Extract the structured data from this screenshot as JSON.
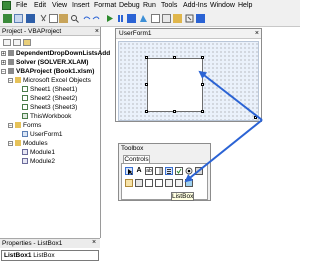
{
  "menu": {
    "items": [
      "File",
      "Edit",
      "View",
      "Insert",
      "Format",
      "Debug",
      "Run",
      "Tools",
      "Add-Ins",
      "Window",
      "Help"
    ]
  },
  "project": {
    "title": "Project - VBAProject",
    "close": "×",
    "tree": [
      {
        "label": "DependentDropDownListsAdd",
        "bold": true,
        "expander": "+"
      },
      {
        "label": "Solver (SOLVER.XLAM)",
        "bold": true,
        "expander": "+"
      },
      {
        "label": "VBAProject (Book1.xlsm)",
        "bold": true,
        "expander": "−"
      },
      {
        "label": "Microsoft Excel Objects",
        "bold": false,
        "expander": "−"
      },
      {
        "label": "Sheet1 (Sheet1)",
        "bold": false,
        "expander": ""
      },
      {
        "label": "Sheet2 (Sheet2)",
        "bold": false,
        "expander": ""
      },
      {
        "label": "Sheet3 (Sheet3)",
        "bold": false,
        "expander": ""
      },
      {
        "label": "ThisWorkbook",
        "bold": false,
        "expander": ""
      },
      {
        "label": "Forms",
        "bold": false,
        "expander": "−"
      },
      {
        "label": "UserForm1",
        "bold": false,
        "expander": ""
      },
      {
        "label": "Modules",
        "bold": false,
        "expander": "−"
      },
      {
        "label": "Module1",
        "bold": false,
        "expander": ""
      },
      {
        "label": "Module2",
        "bold": false,
        "expander": ""
      }
    ]
  },
  "properties": {
    "title": "Properties - ListBox1",
    "close": "×",
    "object_name": "ListBox1",
    "object_type": "ListBox"
  },
  "userform": {
    "title": "UserForm1",
    "close": "×"
  },
  "toolbox": {
    "title": "Toolbox",
    "tab": "Controls",
    "tooltip": "ListBox",
    "controls_row1": [
      "select-arrow-icon",
      "label-A-icon",
      "textbox-ab-icon",
      "combobox-icon",
      "listbox-icon",
      "checkbox-icon",
      "optionbutton-icon",
      "togglebutton-icon"
    ],
    "controls_row2": [
      "frame-icon",
      "commandbutton-icon",
      "tabstrip-icon",
      "multipage-icon",
      "scrollbar-icon",
      "spinbutton-icon",
      "image-icon"
    ]
  },
  "colors": {
    "arrow": "#2b63d4",
    "form_bg": "#eaf1fb",
    "selection_blue": "#3a6fd0"
  }
}
